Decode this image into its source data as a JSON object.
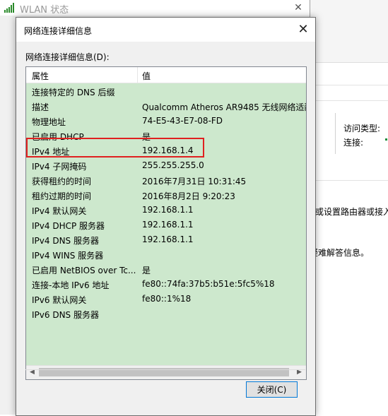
{
  "bg_window": {
    "title": "WLAN 状态"
  },
  "far_window": {
    "access_type_label": "访问类型:",
    "connection_label": "连接:",
    "text_router": "或设置路由器或接入",
    "text_troubleshoot": "疑难解答信息。"
  },
  "dialog": {
    "title": "网络连接详细信息",
    "list_label": "网络连接详细信息(D):",
    "columns": {
      "property": "属性",
      "value": "值"
    },
    "rows": [
      {
        "property": "连接特定的 DNS 后缀",
        "value": ""
      },
      {
        "property": "描述",
        "value": "Qualcomm Atheros AR9485 无线网络适配器"
      },
      {
        "property": "物理地址",
        "value": "74-E5-43-E7-08-FD"
      },
      {
        "property": "已启用 DHCP",
        "value": "是"
      },
      {
        "property": "IPv4 地址",
        "value": "192.168.1.4"
      },
      {
        "property": "IPv4 子网掩码",
        "value": "255.255.255.0"
      },
      {
        "property": "获得租约的时间",
        "value": "2016年7月31日 10:31:45"
      },
      {
        "property": "租约过期的时间",
        "value": "2016年8月2日 9:20:23"
      },
      {
        "property": "IPv4 默认网关",
        "value": "192.168.1.1"
      },
      {
        "property": "IPv4 DHCP 服务器",
        "value": "192.168.1.1"
      },
      {
        "property": "IPv4 DNS 服务器",
        "value": "192.168.1.1"
      },
      {
        "property": "IPv4 WINS 服务器",
        "value": ""
      },
      {
        "property": "已启用 NetBIOS over Tc...",
        "value": "是"
      },
      {
        "property": "连接-本地 IPv6 地址",
        "value": "fe80::74fa:37b5:b51e:5fc5%18"
      },
      {
        "property": "IPv6 默认网关",
        "value": "fe80::1%18"
      },
      {
        "property": "IPv6 DNS 服务器",
        "value": ""
      }
    ],
    "close_button": "关闭(C)"
  },
  "colors": {
    "list_background": "#cde8cd",
    "highlight_border": "#e02020",
    "button_focus_border": "#0078d7"
  },
  "icons": {
    "bg_window_icon": "wifi-signal-icon",
    "dialog_close": "close-icon",
    "bg_close": "close-icon"
  }
}
